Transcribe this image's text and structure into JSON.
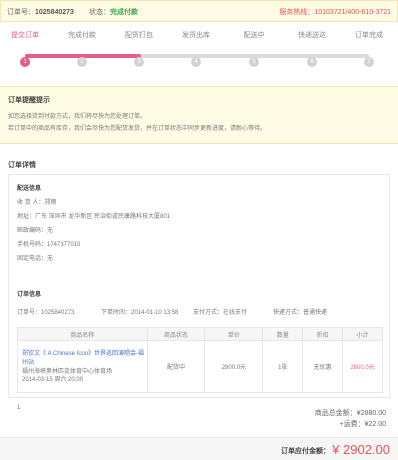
{
  "topbar": {
    "order_label": "订单号：",
    "order_number": "1025840273",
    "status_label": "状态：",
    "status_value": "完成付款",
    "hotline": "服务热线：10103721/400-610-3721"
  },
  "steps": [
    {
      "label": "提交订单",
      "index": "1"
    },
    {
      "label": "完成付款",
      "index": "2"
    },
    {
      "label": "配货打包",
      "index": "3"
    },
    {
      "label": "发货出库",
      "index": "4"
    },
    {
      "label": "配送中",
      "index": "5"
    },
    {
      "label": "快递送达",
      "index": "6"
    },
    {
      "label": "订单完成",
      "index": "7"
    }
  ],
  "hint": {
    "title": "订单提醒提示",
    "line1": "如您选择货到付款方式，我们将尽快为您处理订单。",
    "line2": "若订单中的商品有库存，我们会尽快为您配货发货，并在订单状态中同步更新进度，请耐心等待。"
  },
  "details": {
    "title": "订单详情",
    "receiver_section": "配送信息",
    "receiver": "收 货 人：郑雨",
    "address": "地址：广东 深圳市 龙华新区 民治街道民康路科技大厦801",
    "postcode": "邮政编码：无",
    "mobile": "手机号码：1747377010",
    "phone": "固定电话：无",
    "goods_section": "订单信息",
    "meta": {
      "order_no": "订单号：1025840273",
      "order_time": "下单时间：2014-01-10 13:58",
      "payment": "支付方式：在线支付",
      "shipping": "快递方式：普通快递"
    },
    "table_headers": [
      "商品名称",
      "商品状态",
      "单价",
      "数量",
      "折扣",
      "小计"
    ],
    "items": [
      {
        "name": "郑钦文《 A Chinese Icon》世界巡回演唱会-福州站",
        "venue": "福州海峡奥林匹克体育中心体育场",
        "date": "2014-03-15 周六 20:00",
        "status": "配货中",
        "price": "2800.0元",
        "qty": "1张",
        "discount": "无优惠",
        "subtotal": "2800.0元"
      }
    ],
    "row_index": "1"
  },
  "summary": {
    "goods_total": "商品总金额：¥2880.00",
    "shipping_fee": "+运费：¥22.00",
    "total_label": "订单应付金额：",
    "total_amount": "¥ 2902.00"
  },
  "colors": {
    "accent": "#e45f86",
    "status_green": "#3aa74a",
    "alert_red": "#e8525c",
    "notice_bg": "#fffce6"
  }
}
